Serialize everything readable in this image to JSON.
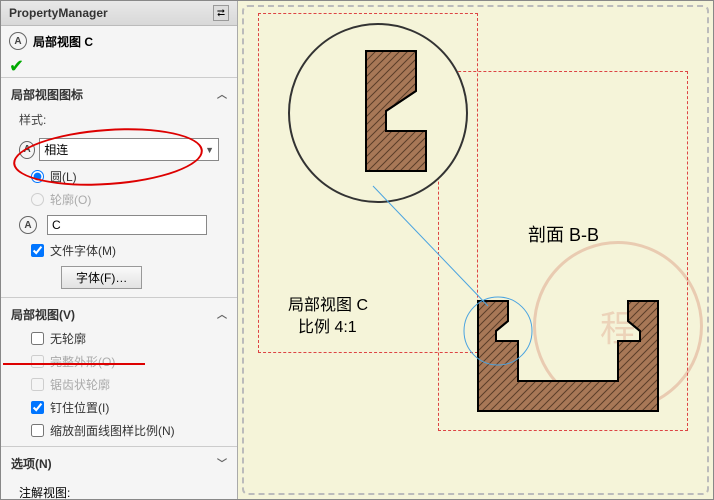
{
  "panel": {
    "title": "PropertyManager",
    "view_title": "局部视图 C",
    "group1": {
      "title": "局部视图图标",
      "style_label": "样式:",
      "style_value": "相连",
      "radio_circle": "圆(L)",
      "radio_outline": "轮廓(O)",
      "name_value": "C",
      "file_font": "文件字体(M)",
      "font_btn": "字体(F)…"
    },
    "group2": {
      "title": "局部视图(V)",
      "no_outline": "无轮廓",
      "full_outline": "完整外形(O)",
      "jagged": "锯齿状轮廓",
      "pin_position": "钉住位置(I)",
      "scale_hatch": "缩放剖面线图样比例(N)"
    },
    "options": "选项(N)",
    "annotation": "注解视图:"
  },
  "canvas": {
    "section_label": "剖面 B-B",
    "detail_label_1": "局部视图 C",
    "detail_label_2": "比例 4:1"
  }
}
